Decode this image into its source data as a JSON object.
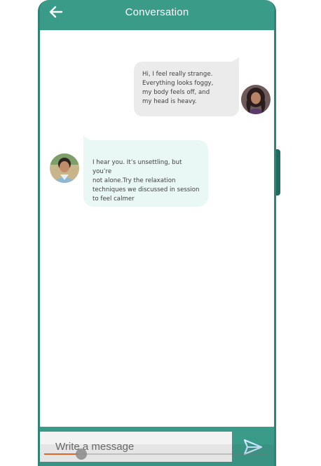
{
  "header": {
    "title": "Conversation",
    "back_icon": "arrow-left-icon"
  },
  "messages": [
    {
      "sender": "me",
      "text": "Hi, I feel really strange.\nEverything looks foggy,\nmy body feels off, and\nmy head is heavy.",
      "avatar_icon": "user-avatar"
    },
    {
      "sender": "therapist",
      "text": "I hear you. It’s unsettling, but you’re\nnot alone.Try the relaxation\ntechniques we discussed in session\nto  feel calmer",
      "avatar_icon": "therapist-avatar"
    }
  ],
  "composer": {
    "placeholder": "Write a message",
    "send_icon": "send-icon"
  },
  "media_progress": {
    "fraction": 0.15
  },
  "colors": {
    "primary": "#3a9b88",
    "frame": "#2e8576",
    "sent_bubble": "#ebebeb",
    "received_bubble": "#eaf8f5",
    "scrubber_fill": "#e0662a"
  }
}
